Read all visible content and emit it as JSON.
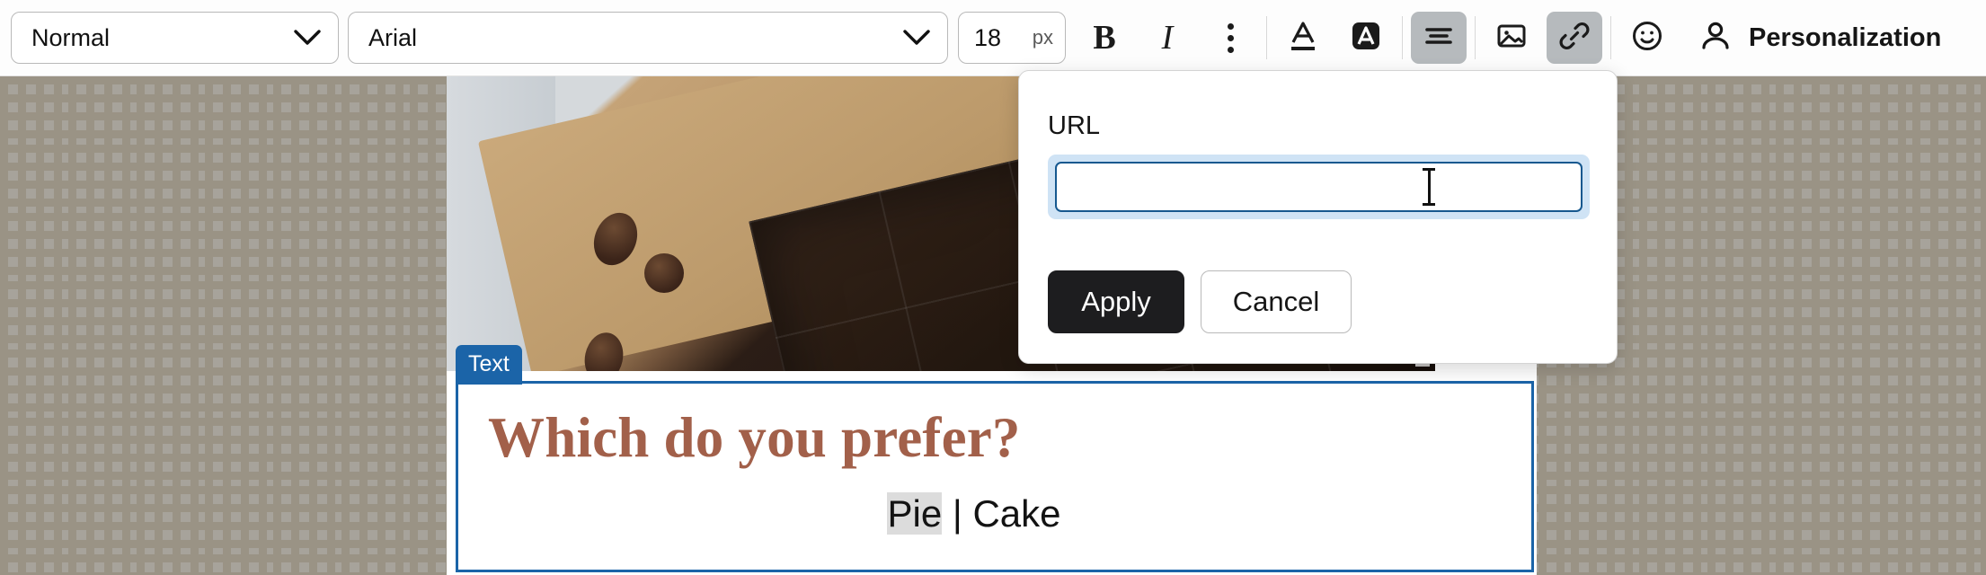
{
  "toolbar": {
    "paragraph_style": {
      "value": "Normal",
      "icon": "chevron-down-icon"
    },
    "font_family": {
      "value": "Arial",
      "icon": "chevron-down-icon"
    },
    "font_size": {
      "value": "18",
      "unit": "px"
    },
    "bold_label": "B",
    "italic_label": "I",
    "more_options_icon": "vertical-dots-icon",
    "text_color_icon": "text-color-a-underline-icon",
    "highlight_color_icon": "highlight-a-filled-icon",
    "align_icon": "align-center-icon",
    "image_icon": "image-icon",
    "link_icon": "link-chain-icon",
    "emoji_icon": "smiley-face-icon",
    "account_icon": "person-icon",
    "personalization_label": "Personalization",
    "active_buttons": [
      "align-center-icon",
      "link-chain-icon"
    ]
  },
  "link_popup": {
    "field_label": "URL",
    "url_value": "",
    "url_placeholder": "",
    "apply_label": "Apply",
    "cancel_label": "Cancel",
    "cursor_icon": "i-beam-text-cursor"
  },
  "canvas": {
    "image_block": {
      "name": "chocolate bar on wooden board with coffee beans",
      "resize_handle_icon": "resize-corner-icon"
    },
    "text_block": {
      "tag_label": "Text",
      "heading": "Which do you prefer?",
      "option_selected": "Pie",
      "separator": " | ",
      "option_other": "Cake"
    }
  },
  "colors": {
    "accent_blue": "#1b64a8",
    "heading_brown": "#a2604a",
    "apply_button_bg": "#1d1d1f",
    "input_focus_border": "#16588f",
    "input_focus_ring": "#cfe3f5",
    "selection_highlight": "#dcdcdc",
    "toolbar_active_bg": "#b6babd",
    "canvas_bg": "#f3efe4",
    "scrim": "rgba(80,78,72,0.47)"
  }
}
